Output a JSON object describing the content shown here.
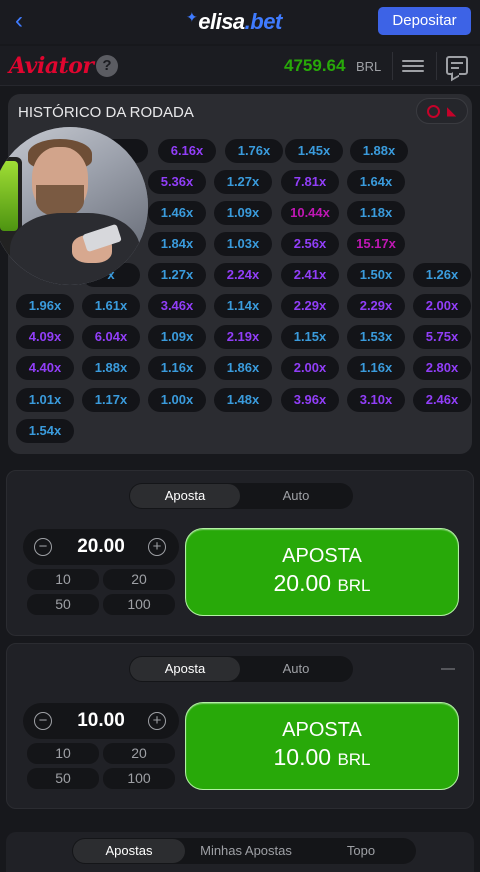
{
  "topbar": {
    "brand_prefix": "elisa",
    "brand_suffix": ".bet",
    "deposit_label": "Depositar"
  },
  "game": {
    "logo": "Aviator",
    "help_label": "?",
    "balance": "4759.64",
    "currency": "BRL"
  },
  "history": {
    "title": "HISTÓRICO DA RODADA",
    "rows": [
      [
        {
          "v": "x",
          "c": "blue"
        },
        {
          "v": "6.16x",
          "c": "purple"
        },
        {
          "v": "1.76x",
          "c": "blue"
        },
        {
          "v": "1.45x",
          "c": "blue"
        },
        {
          "v": "1.88x",
          "c": "blue"
        }
      ],
      [
        {
          "v": "5.36x",
          "c": "purple"
        },
        {
          "v": "1.27x",
          "c": "blue"
        },
        {
          "v": "7.81x",
          "c": "purple"
        },
        {
          "v": "1.64x",
          "c": "blue"
        }
      ],
      [
        {
          "v": "1.46x",
          "c": "blue"
        },
        {
          "v": "1.09x",
          "c": "blue"
        },
        {
          "v": "10.44x",
          "c": "pink"
        },
        {
          "v": "1.18x",
          "c": "blue"
        }
      ],
      [
        {
          "v": "1.84x",
          "c": "blue"
        },
        {
          "v": "1.03x",
          "c": "blue"
        },
        {
          "v": "2.56x",
          "c": "purple"
        },
        {
          "v": "15.17x",
          "c": "pink"
        }
      ],
      [
        {
          "v": "x",
          "c": "blue"
        },
        {
          "v": "1.27x",
          "c": "blue"
        },
        {
          "v": "2.24x",
          "c": "purple"
        },
        {
          "v": "2.41x",
          "c": "purple"
        },
        {
          "v": "1.50x",
          "c": "blue"
        },
        {
          "v": "1.26x",
          "c": "blue"
        }
      ],
      [
        {
          "v": "1.96x",
          "c": "blue"
        },
        {
          "v": "1.61x",
          "c": "blue"
        },
        {
          "v": "3.46x",
          "c": "purple"
        },
        {
          "v": "1.14x",
          "c": "blue"
        },
        {
          "v": "2.29x",
          "c": "purple"
        },
        {
          "v": "2.29x",
          "c": "purple"
        },
        {
          "v": "2.00x",
          "c": "purple"
        }
      ],
      [
        {
          "v": "4.09x",
          "c": "purple"
        },
        {
          "v": "6.04x",
          "c": "purple"
        },
        {
          "v": "1.09x",
          "c": "blue"
        },
        {
          "v": "2.19x",
          "c": "purple"
        },
        {
          "v": "1.15x",
          "c": "blue"
        },
        {
          "v": "1.53x",
          "c": "blue"
        },
        {
          "v": "5.75x",
          "c": "purple"
        }
      ],
      [
        {
          "v": "4.40x",
          "c": "purple"
        },
        {
          "v": "1.88x",
          "c": "blue"
        },
        {
          "v": "1.16x",
          "c": "blue"
        },
        {
          "v": "1.86x",
          "c": "blue"
        },
        {
          "v": "2.00x",
          "c": "purple"
        },
        {
          "v": "1.16x",
          "c": "blue"
        },
        {
          "v": "2.80x",
          "c": "purple"
        }
      ],
      [
        {
          "v": "1.01x",
          "c": "blue"
        },
        {
          "v": "1.17x",
          "c": "blue"
        },
        {
          "v": "1.00x",
          "c": "blue"
        },
        {
          "v": "1.48x",
          "c": "blue"
        },
        {
          "v": "3.96x",
          "c": "purple"
        },
        {
          "v": "3.10x",
          "c": "purple"
        },
        {
          "v": "2.46x",
          "c": "purple"
        }
      ],
      [
        {
          "v": "1.54x",
          "c": "blue"
        }
      ]
    ]
  },
  "bet1": {
    "tab_bet": "Aposta",
    "tab_auto": "Auto",
    "minus": "−",
    "plus": "+",
    "amount": "20.00",
    "quick": [
      "10",
      "20",
      "50",
      "100"
    ],
    "button_label": "APOSTA",
    "button_amount": "20.00",
    "button_currency": "BRL"
  },
  "bet2": {
    "tab_bet": "Aposta",
    "tab_auto": "Auto",
    "minus": "−",
    "plus": "+",
    "amount": "10.00",
    "quick": [
      "10",
      "20",
      "50",
      "100"
    ],
    "button_label": "APOSTA",
    "button_amount": "10.00",
    "button_currency": "BRL"
  },
  "bottom_tabs": {
    "bets": "Apostas",
    "my_bets": "Minhas Apostas",
    "top": "Topo"
  },
  "colors": {
    "accent": "#3d63e6",
    "win_green": "#28a909",
    "multiplier_blue": "#3a9bdc",
    "multiplier_purple": "#913ef8",
    "multiplier_pink": "#c017b4",
    "logo_red": "#e0052f"
  }
}
